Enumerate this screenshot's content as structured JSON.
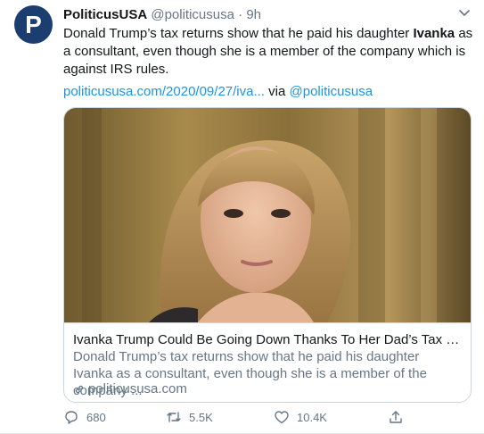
{
  "account": {
    "display_name": "PoliticusUSA",
    "handle": "@politicususa",
    "separator": "·",
    "timestamp": "9h",
    "avatar_letter": "P"
  },
  "tweet": {
    "text_before": "Donald Trump’s tax returns show that he paid his daughter ",
    "text_bold": "Ivanka",
    "text_after": " as a consultant, even though she is a member of the company which is against IRS rules.",
    "link": "politicususa.com/2020/09/27/iva...",
    "via_label": "via",
    "via_handle": "@politicususa"
  },
  "card": {
    "title": "Ivanka Trump Could Be Going Down Thanks To Her Dad’s Tax Fra...",
    "description": "Donald Trump’s tax returns show that he paid his daughter Ivanka as a consultant, even though she is a member of the company ...",
    "domain": "politicususa.com"
  },
  "actions": {
    "replies": "680",
    "retweets": "5.5K",
    "likes": "10.4K"
  },
  "colors": {
    "link": "#1b95e0",
    "secondary": "#657786",
    "avatar": "#1b3d6f"
  },
  "icons": [
    "chevron-down-icon",
    "reply-icon",
    "retweet-icon",
    "like-icon",
    "share-icon",
    "link-icon"
  ]
}
